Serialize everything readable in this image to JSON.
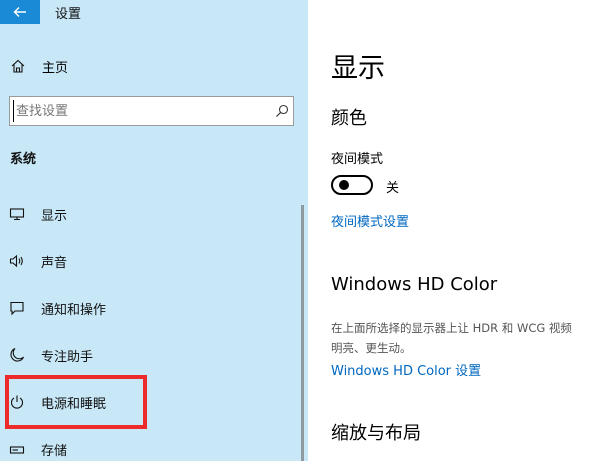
{
  "window": {
    "title": "设置"
  },
  "sidebar": {
    "home_label": "主页",
    "search_placeholder": "查找设置",
    "section": "系统",
    "items": [
      {
        "label": "显示",
        "icon": "monitor-icon"
      },
      {
        "label": "声音",
        "icon": "speaker-icon"
      },
      {
        "label": "通知和操作",
        "icon": "notification-icon"
      },
      {
        "label": "专注助手",
        "icon": "moon-icon"
      },
      {
        "label": "电源和睡眠",
        "icon": "power-icon"
      },
      {
        "label": "存储",
        "icon": "storage-icon"
      }
    ]
  },
  "main": {
    "title": "显示",
    "color_heading": "颜色",
    "night_light_label": "夜间模式",
    "night_light_state": "关",
    "night_light_on": false,
    "night_light_settings_link": "夜间模式设置",
    "hdr_heading": "Windows HD Color",
    "hdr_desc_line1": "在上面所选择的显示器上让 HDR 和 WCG 视频",
    "hdr_desc_line2": "明亮、更生动。",
    "hdr_settings_link": "Windows HD Color 设置",
    "scale_heading": "缩放与布局"
  },
  "colors": {
    "sidebar_bg": "#c9e8f7",
    "accent": "#1a8ad6",
    "link": "#0067c0",
    "highlight": "#ee2b2b"
  }
}
